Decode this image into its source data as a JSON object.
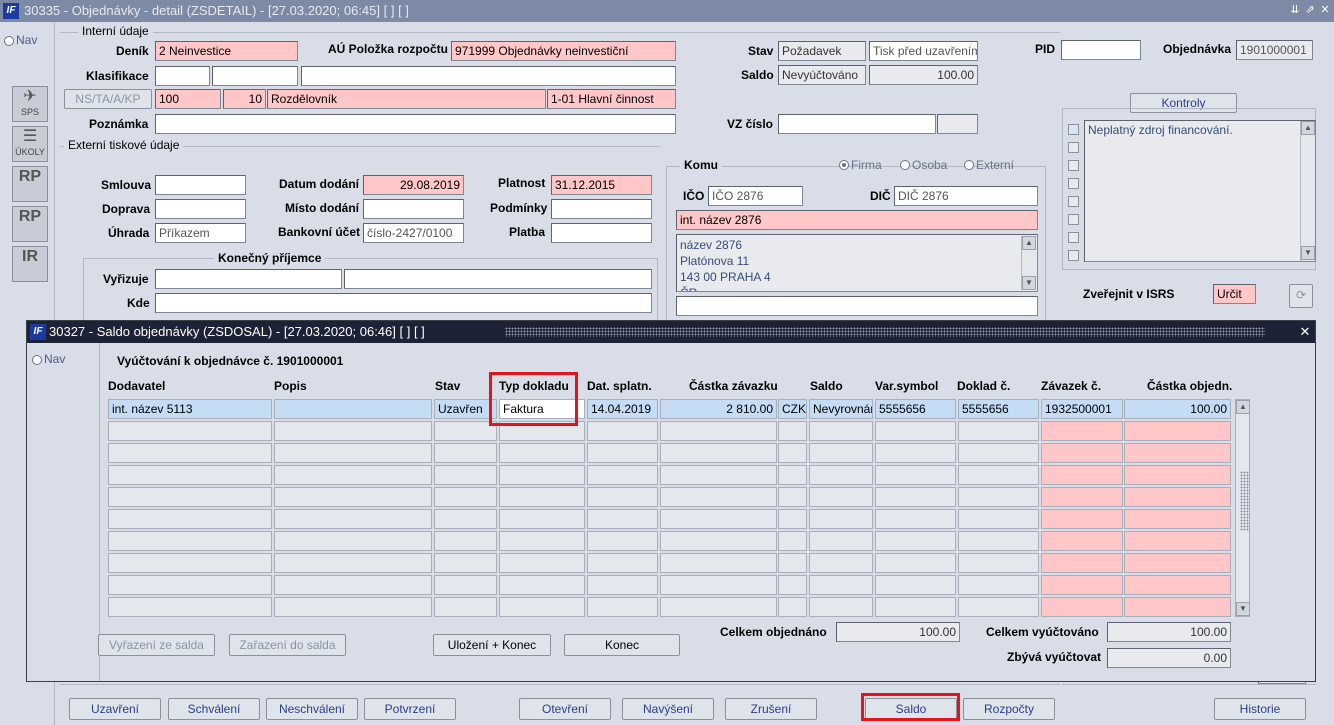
{
  "window": {
    "title": "30335 - Objednávky - detail (ZSDETAIL) - [27.03.2020; 06:45]  [ ]  [ ]",
    "logo": "IF",
    "controls": [
      "⇊",
      "⇗",
      "✕"
    ]
  },
  "nav": {
    "label": "Nav"
  },
  "side_icons": [
    {
      "name": "sps",
      "big": "✈",
      "small": "SPS"
    },
    {
      "name": "ukoly",
      "big": "☰",
      "small": "ÚKOLY"
    },
    {
      "name": "rp1",
      "big": "RP",
      "small": ""
    },
    {
      "name": "rp2",
      "big": "RP",
      "small": ""
    },
    {
      "name": "ir",
      "big": "IR",
      "small": ""
    }
  ],
  "internal": {
    "section_title": "Interní údaje",
    "denik_label": "Deník",
    "denik_value": "2 Neinvestice",
    "au_label": "AÚ Položka rozpočtu",
    "au_value": "971999 Objednávky neinvestiční",
    "klasifikace_label": "Klasifikace",
    "nsta_label": "NS/TA/A/KP",
    "nsta_v1": "100",
    "nsta_v2": "10",
    "nsta_v3": "Rozdělovník",
    "nsta_v4": "1-01 Hlavní činnost",
    "poznamka_label": "Poznámka",
    "stav_label": "Stav",
    "stav_value": "Požadavek",
    "stav_tisk": "Tisk před uzavřením",
    "saldo_label": "Saldo",
    "saldo_value": "Nevyúčtováno",
    "saldo_amount": "100.00",
    "vz_label": "VZ číslo",
    "pid_label": "PID",
    "objednavka_label": "Objednávka",
    "objednavka_value": "1901000001"
  },
  "external": {
    "section_title": "Externí tiskové údaje",
    "smlouva_label": "Smlouva",
    "doprava_label": "Doprava",
    "uhrada_label": "Úhrada",
    "uhrada_value": "Příkazem",
    "datum_label": "Datum dodání",
    "datum_value": "29.08.2019",
    "misto_label": "Místo dodání",
    "bank_label": "Bankovní účet",
    "bank_value": "číslo-2427/0100",
    "platnost_label": "Platnost",
    "platnost_value": "31.12.2015",
    "podminky_label": "Podmínky",
    "platba_label": "Platba",
    "konecny_title": "Konečný příjemce",
    "vyrizuje_label": "Vyřizuje",
    "kde_label": "Kde"
  },
  "komu": {
    "title": "Komu",
    "opt_firma": "Firma",
    "opt_osoba": "Osoba",
    "opt_externi": "Externí",
    "ico_label": "IČO",
    "ico_value": "IČO 2876",
    "dic_label": "DIČ",
    "dic_value": "DIČ 2876",
    "int_nazev": "int. název 2876",
    "addr_line1": "název 2876",
    "addr_line2": "Platónova 11",
    "addr_line3": "143 00  PRAHA 4",
    "addr_line4": "ČR"
  },
  "kontroly": {
    "button": "Kontroly",
    "items": [
      "Neplatný zdroj financování."
    ]
  },
  "isrs": {
    "label": "Zveřejnit v ISRS",
    "value": "Určit"
  },
  "bottom_buttons": {
    "uzavreni": "Uzavření",
    "schvaleni": "Schválení",
    "neschvaleni": "Neschválení",
    "potvrzeni": "Potvrzení",
    "otevreni": "Otevření",
    "navyseni": "Navýšení",
    "zruseni": "Zrušení",
    "saldo": "Saldo",
    "rozpocty": "Rozpočty",
    "historie": "Historie"
  },
  "dialog": {
    "title": "30327 - Saldo objednávky (ZSDOSAL) - [27.03.2020; 06:46]  [ ]  [ ]",
    "logo": "IF",
    "close": "✕",
    "nav_label": "Nav",
    "heading": "Vyúčtování k objednávce č. 1901000001",
    "columns": [
      "Dodavatel",
      "Popis",
      "Stav",
      "Typ dokladu",
      "Dat. splatn.",
      "Částka závazku",
      "Saldo",
      "Var.symbol",
      "Doklad č.",
      "Závazek č.",
      "Částka objedn."
    ],
    "rows": [
      {
        "dodavatel": "int. název 5113",
        "popis": "",
        "stav": "Uzavřen",
        "typ": "Faktura",
        "datum": "14.04.2019",
        "castka": "2 810.00",
        "mena": "CZK",
        "saldo": "Nevyrovnán",
        "var": "5555656",
        "doklad": "5555656",
        "zavazek": "1932500001",
        "objedn": "100.00"
      }
    ],
    "celkem_obj_label": "Celkem objednáno",
    "celkem_obj_value": "100.00",
    "celkem_vyuc_label": "Celkem vyúčtováno",
    "celkem_vyuc_value": "100.00",
    "zbyva_label": "Zbývá vyúčtovat",
    "zbyva_value": "0.00",
    "btn_vyrazeni": "Vyřazení ze salda",
    "btn_zarazeni": "Zařazení do salda",
    "btn_ulozeni": "Uložení + Konec",
    "btn_konec": "Konec"
  }
}
